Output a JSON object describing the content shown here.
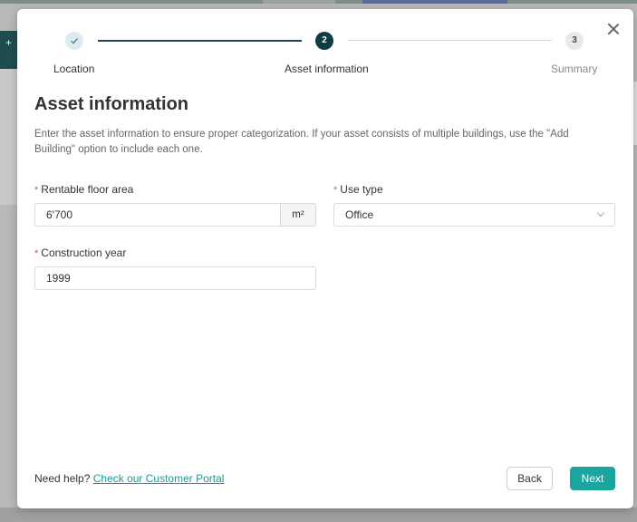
{
  "stepper": {
    "steps": [
      {
        "number": "",
        "label": "Location",
        "state": "completed"
      },
      {
        "number": "2",
        "label": "Asset information",
        "state": "active"
      },
      {
        "number": "3",
        "label": "Summary",
        "state": "pending"
      }
    ]
  },
  "page": {
    "title": "Asset information",
    "description": "Enter the asset information to ensure proper categorization. If your asset consists of multiple buildings, use the \"Add Building\" option to include each one."
  },
  "form": {
    "floor_area": {
      "label": "Rentable floor area",
      "value": "6'700",
      "unit": "m²",
      "required": true
    },
    "use_type": {
      "label": "Use type",
      "value": "Office",
      "required": true
    },
    "construction_year": {
      "label": "Construction year",
      "value": "1999",
      "required": true
    }
  },
  "footer": {
    "help_text": "Need help?",
    "help_link": "Check our Customer Portal",
    "back_label": "Back",
    "next_label": "Next"
  },
  "colors": {
    "accent": "#1aa59e",
    "active_step": "#0f3d44",
    "required_marker": "#e05a3a"
  }
}
